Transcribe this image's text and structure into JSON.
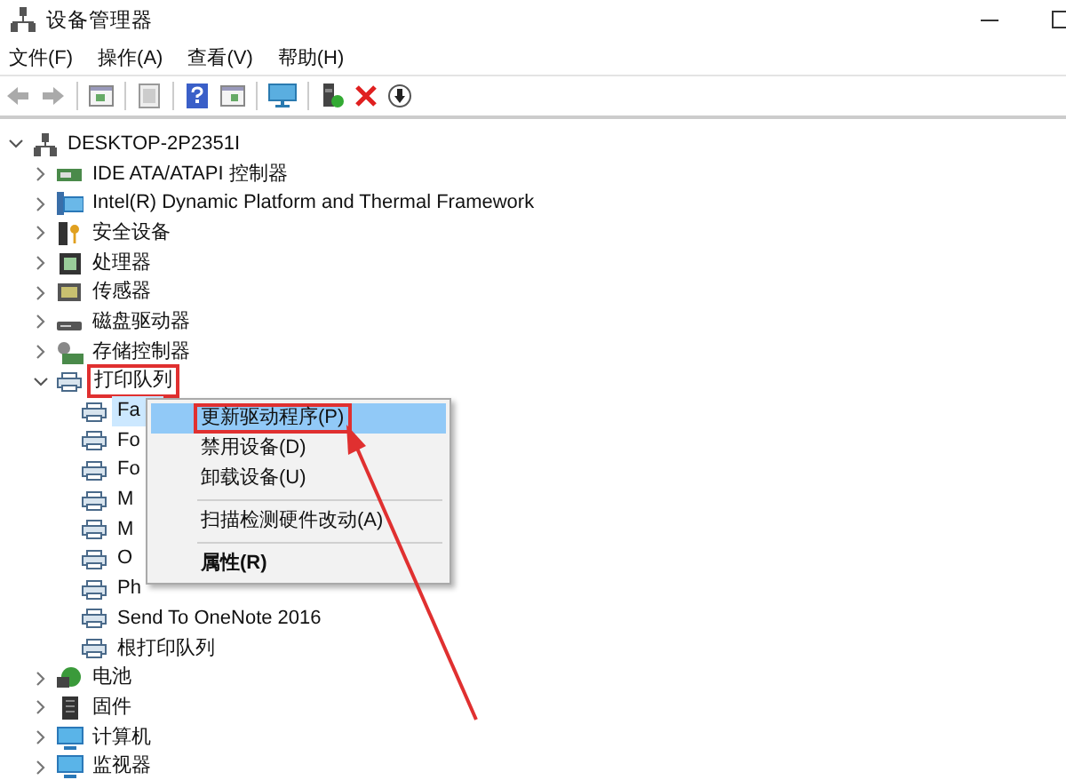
{
  "window": {
    "title": "设备管理器"
  },
  "menu_bar": [
    {
      "label": "文件(F)"
    },
    {
      "label": "操作(A)"
    },
    {
      "label": "查看(V)"
    },
    {
      "label": "帮助(H)"
    }
  ],
  "tree": {
    "label": "DESKTOP-2P2351I",
    "expanded": true,
    "selected": false,
    "marked": false,
    "children": [
      {
        "label": "IDE ATA/ATAPI 控制器",
        "expanded": false,
        "selected": false,
        "marked": false
      },
      {
        "label": "Intel(R) Dynamic Platform and Thermal Framework",
        "expanded": false,
        "selected": false,
        "marked": false
      },
      {
        "label": "安全设备",
        "expanded": false,
        "selected": false,
        "marked": false
      },
      {
        "label": "处理器",
        "expanded": false,
        "selected": false,
        "marked": false
      },
      {
        "label": "传感器",
        "expanded": false,
        "selected": false,
        "marked": false
      },
      {
        "label": "磁盘驱动器",
        "expanded": false,
        "selected": false,
        "marked": false
      },
      {
        "label": "存储控制器",
        "expanded": false,
        "selected": false,
        "marked": false
      },
      {
        "label": "打印队列",
        "expanded": true,
        "selected": false,
        "marked": true,
        "children": [
          {
            "label": "Fa",
            "selected": true,
            "marked": false
          },
          {
            "label": "Fo",
            "selected": false,
            "marked": false
          },
          {
            "label": "Fo",
            "selected": false,
            "marked": false
          },
          {
            "label": "M",
            "selected": false,
            "marked": false
          },
          {
            "label": "M",
            "selected": false,
            "marked": false
          },
          {
            "label": "O",
            "selected": false,
            "marked": false
          },
          {
            "label": "Ph",
            "selected": false,
            "marked": false
          },
          {
            "label": "Send To OneNote 2016",
            "selected": false,
            "marked": false
          },
          {
            "label": "根打印队列",
            "selected": false,
            "marked": false
          }
        ]
      },
      {
        "label": "电池",
        "expanded": false,
        "selected": false,
        "marked": false
      },
      {
        "label": "固件",
        "expanded": false,
        "selected": false,
        "marked": false
      },
      {
        "label": "计算机",
        "expanded": false,
        "selected": false,
        "marked": false
      },
      {
        "label": "监视器",
        "expanded": false,
        "selected": false,
        "marked": false
      }
    ]
  },
  "context_menu": {
    "items": [
      {
        "kind": "item",
        "label": "更新驱动程序(P)",
        "selected": true,
        "default": false,
        "marked": true
      },
      {
        "kind": "item",
        "label": "禁用设备(D)",
        "selected": false,
        "default": false,
        "marked": false
      },
      {
        "kind": "item",
        "label": "卸载设备(U)",
        "selected": false,
        "default": false,
        "marked": false
      },
      {
        "kind": "separator"
      },
      {
        "kind": "item",
        "label": "扫描检测硬件改动(A)",
        "selected": false,
        "default": false,
        "marked": false
      },
      {
        "kind": "separator"
      },
      {
        "kind": "item",
        "label": "属性(R)",
        "selected": false,
        "default": true,
        "marked": false
      }
    ]
  }
}
